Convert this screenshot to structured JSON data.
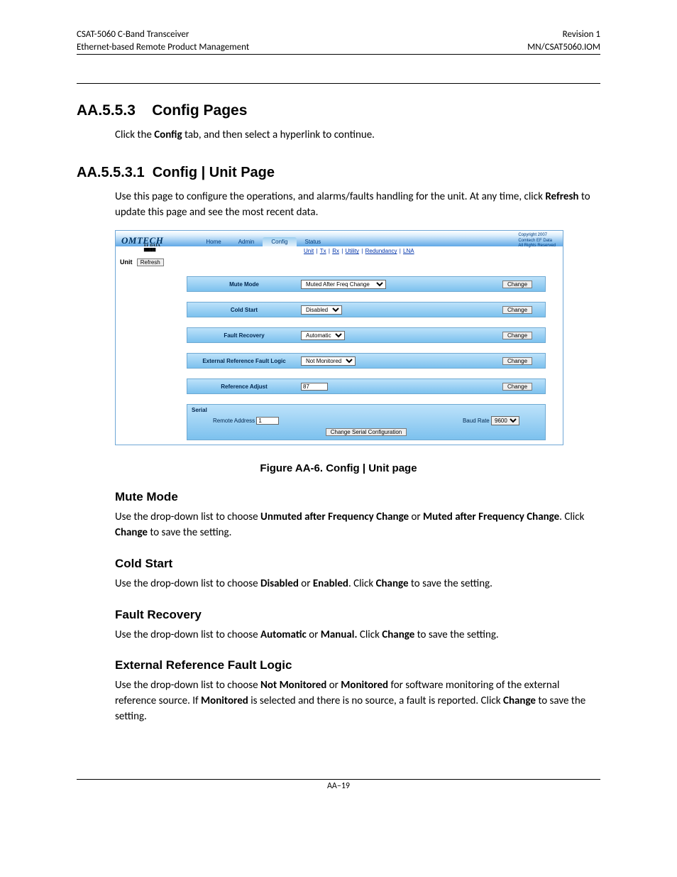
{
  "header": {
    "left_line1": "CSAT-5060 C-Band Transceiver",
    "left_line2": "Ethernet-based Remote Product Management",
    "right_line1": "Revision 1",
    "right_line2": "MN/CSAT5060.IOM"
  },
  "section1": {
    "num": "AA.5.5.3",
    "title": "Config Pages",
    "intro_pre": "Click the ",
    "intro_bold": "Config",
    "intro_post": " tab, and then select a hyperlink to continue."
  },
  "section2": {
    "num": "AA.5.5.3.1",
    "title": "Config | Unit Page",
    "intro_pre": "Use this page to configure the operations, and alarms/faults handling for the unit. At any time, click ",
    "intro_bold": "Refresh",
    "intro_post": " to update this page and see the most recent data."
  },
  "shot": {
    "brand": "OMTECH",
    "brand_sub": "EF DATA ▇▇▇▇",
    "tabs": {
      "home": "Home",
      "admin": "Admin",
      "config": "Config",
      "status": "Status"
    },
    "subnav": {
      "unit": "Unit",
      "tx": "Tx",
      "rx": "Rx",
      "utility": "Utility",
      "redundancy": "Redundancy",
      "lna": "LNA"
    },
    "copyright_l1": "Copyright 2007",
    "copyright_l2": "Comtech EF Data",
    "copyright_l3": "All Rights Reserved",
    "unit_label": "Unit",
    "refresh": "Refresh",
    "rows": [
      {
        "label": "Mute Mode",
        "value": "Muted After Freq Change",
        "button": "Change"
      },
      {
        "label": "Cold Start",
        "value": "Disabled",
        "button": "Change"
      },
      {
        "label": "Fault Recovery",
        "value": "Automatic",
        "button": "Change"
      },
      {
        "label": "External Reference Fault Logic",
        "value": "Not Monitored",
        "button": "Change"
      },
      {
        "label": "Reference Adjust",
        "value": "87",
        "button": "Change",
        "text": true
      }
    ],
    "serial": {
      "title": "Serial",
      "remote_addr_label": "Remote Address",
      "remote_addr_value": "1",
      "baud_label": "Baud Rate",
      "baud_value": "9600",
      "button": "Change Serial Configuration"
    }
  },
  "caption": "Figure AA-6. Config | Unit page",
  "mute": {
    "title": "Mute Mode",
    "t1": "Use the drop-down list to choose ",
    "b1": "Unmuted after Frequency Change",
    "t2": " or ",
    "b2": "Muted after Frequency Change",
    "t3": ". Click ",
    "b3": "Change",
    "t4": " to save the setting."
  },
  "cold": {
    "title": "Cold Start",
    "t1": "Use the drop-down list to choose ",
    "b1": "Disabled",
    "t2": " or ",
    "b2": "Enabled",
    "t3": ". Click ",
    "b3": "Change",
    "t4": " to save the setting."
  },
  "fault": {
    "title": "Fault Recovery",
    "t1": "Use the drop-down list to choose ",
    "b1": "Automatic",
    "t2": " or ",
    "b2": "Manual.",
    "t3": " Click ",
    "b3": "Change",
    "t4": " to save the setting."
  },
  "ext": {
    "title": "External Reference Fault Logic",
    "t1": "Use the drop-down list to choose ",
    "b1": "Not Monitored",
    "t2": " or ",
    "b2": "Monitored",
    "t3": " for software monitoring of the external reference source. If ",
    "b3": "Monitored",
    "t4": " is selected and there is no source, a fault is reported. Click ",
    "b4": "Change",
    "t5": " to save the setting."
  },
  "page_number": "AA–19"
}
